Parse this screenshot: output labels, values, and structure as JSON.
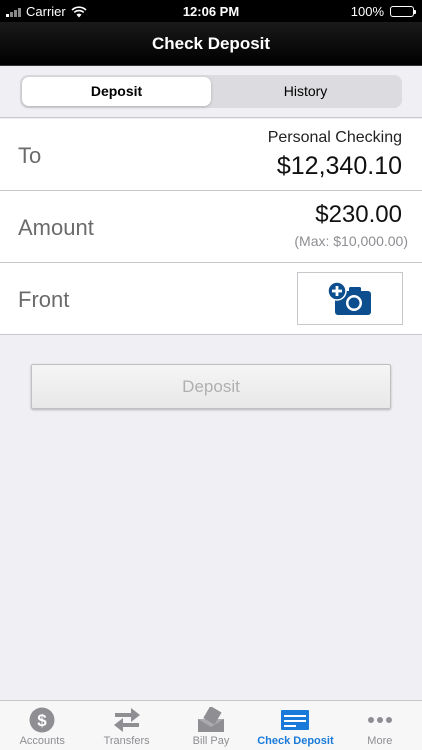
{
  "status_bar": {
    "carrier": "Carrier",
    "time": "12:06 PM",
    "battery": "100%"
  },
  "nav": {
    "title": "Check Deposit"
  },
  "segments": [
    {
      "label": "Deposit",
      "active": true
    },
    {
      "label": "History",
      "active": false
    }
  ],
  "to_row": {
    "label": "To",
    "account_name": "Personal Checking",
    "balance": "$12,340.10"
  },
  "amount_row": {
    "label": "Amount",
    "amount": "$230.00",
    "max": "(Max: $10,000.00)"
  },
  "front_row": {
    "label": "Front",
    "icon": "add-camera-icon"
  },
  "deposit_button": {
    "label": "Deposit"
  },
  "tabs": [
    {
      "label": "Accounts",
      "icon": "dollar-icon",
      "active": false
    },
    {
      "label": "Transfers",
      "icon": "transfer-arrows-icon",
      "active": false
    },
    {
      "label": "Bill Pay",
      "icon": "bill-pay-icon",
      "active": false
    },
    {
      "label": "Check Deposit",
      "icon": "check-icon",
      "active": true
    },
    {
      "label": "More",
      "icon": "more-dots-icon",
      "active": false
    }
  ],
  "colors": {
    "accent": "#1a7ad9",
    "camera_blue": "#0d4e8f",
    "nav_bg": "#000000"
  }
}
